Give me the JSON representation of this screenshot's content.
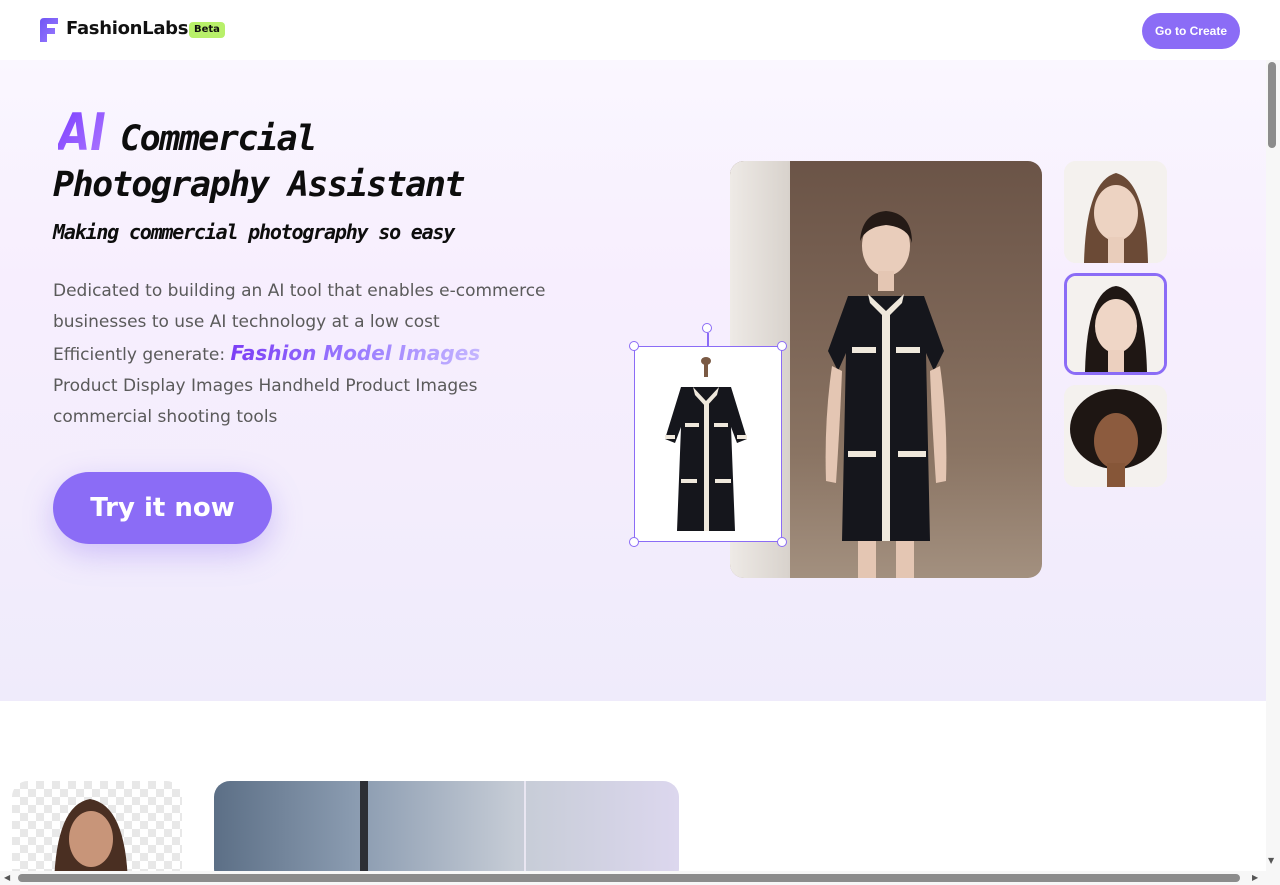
{
  "header": {
    "brand": "FashionLabs",
    "badge": "Beta",
    "cta_label": "Go to Create"
  },
  "hero": {
    "title_accent": "AI",
    "title_line1": "Commercial",
    "title_line2": "Photography Assistant",
    "subtitle": "Making commercial photography so easy",
    "desc_line1": "Dedicated to building an AI tool that enables e-commerce",
    "desc_line2": "businesses to use AI technology at a low cost",
    "desc_prefix": "Efficiently generate: ",
    "highlight": "Fashion Model Images",
    "desc_line4": "Product Display Images  Handheld Product Images",
    "desc_line5": "commercial shooting tools",
    "try_label": "Try it now"
  },
  "colors": {
    "accent": "#8b6cf6",
    "badge": "#b8f06a"
  }
}
